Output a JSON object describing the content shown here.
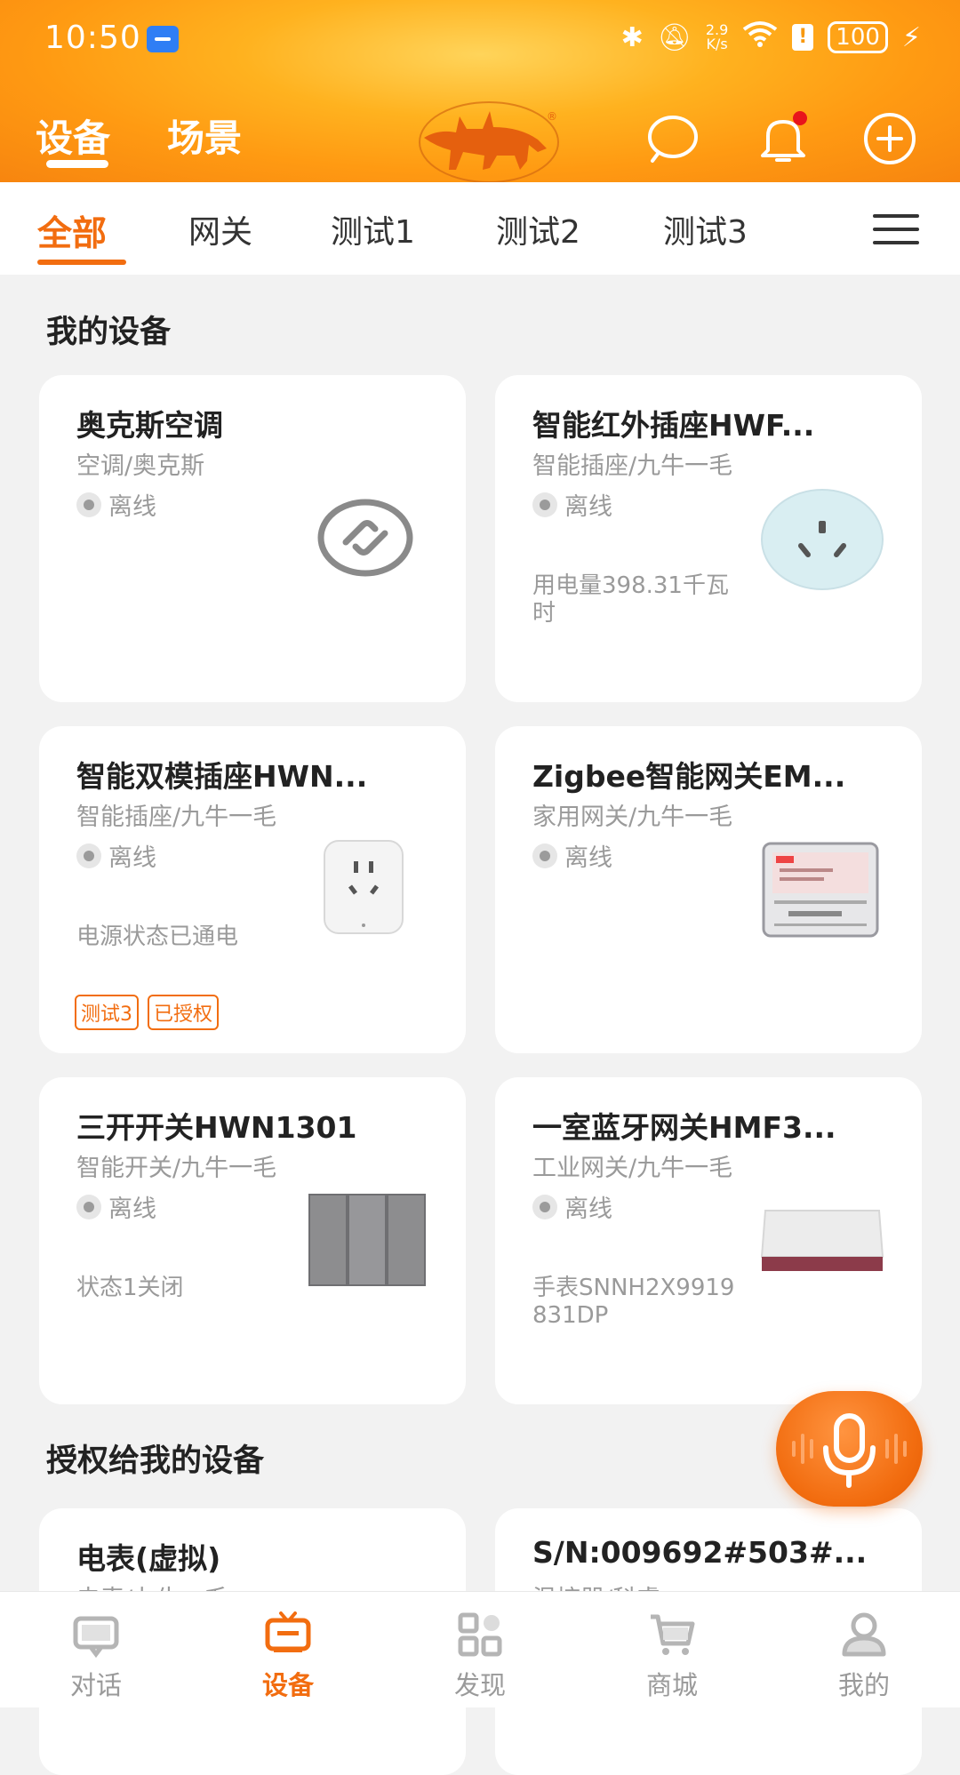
{
  "status_bar": {
    "time": "10:50",
    "speed": "2.9\nK/s",
    "battery": "100"
  },
  "header": {
    "tabs": [
      "设备",
      "场景"
    ]
  },
  "categories": [
    "全部",
    "网关",
    "测试1",
    "测试2",
    "测试3"
  ],
  "sections": {
    "mine": "我的设备",
    "authorized": "授权给我的设备"
  },
  "devices": [
    {
      "name": "奥克斯空调",
      "sub": "空调/奥克斯",
      "status": "离线",
      "info": "",
      "tags": []
    },
    {
      "name": "智能红外插座HWF...",
      "sub": "智能插座/九牛一毛",
      "status": "离线",
      "info": "用电量398.31千瓦时",
      "tags": []
    },
    {
      "name": "智能双模插座HWN...",
      "sub": "智能插座/九牛一毛",
      "status": "离线",
      "info": "电源状态已通电",
      "tags": [
        "测试3",
        "已授权"
      ]
    },
    {
      "name": "Zigbee智能网关EM...",
      "sub": "家用网关/九牛一毛",
      "status": "离线",
      "info": "",
      "tags": []
    },
    {
      "name": "三开开关HWN1301",
      "sub": "智能开关/九牛一毛",
      "status": "离线",
      "info": "状态1关闭",
      "tags": []
    },
    {
      "name": "一室蓝牙网关HMF3...",
      "sub": "工业网关/九牛一毛",
      "status": "离线",
      "info": "手表SNNH2X9919831DP",
      "tags": []
    }
  ],
  "authorized_devices": [
    {
      "name": "电表(虚拟)",
      "sub": "电表/九牛一毛"
    },
    {
      "name": "S/N:009692#503#...",
      "sub": "温控器/科睿"
    }
  ],
  "bottom_nav": [
    "对话",
    "设备",
    "发现",
    "商城",
    "我的"
  ],
  "colors": {
    "accent": "#f26d10",
    "header": "#ffa419"
  }
}
